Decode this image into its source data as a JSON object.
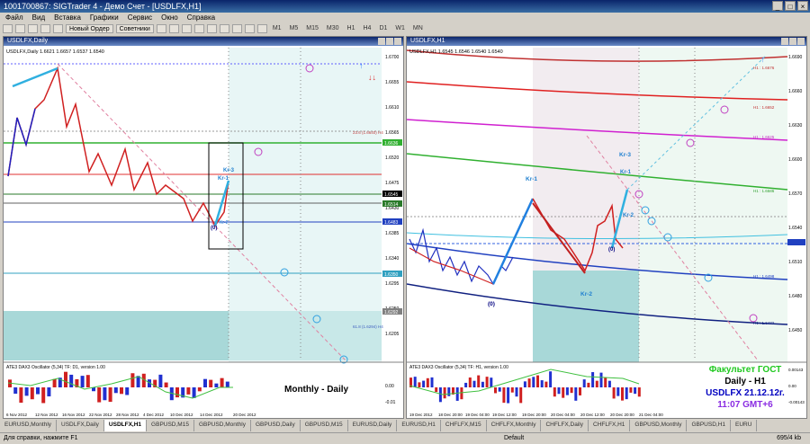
{
  "app": {
    "title": "1001700867: SIGTrader 4 - Демо Счет - [USDLFX,H1]",
    "menu": [
      "Файл",
      "Вид",
      "Вставка",
      "Графики",
      "Сервис",
      "Окно",
      "Справка"
    ],
    "toolbar": {
      "new_order": "Новый Ордер",
      "advisors": "Советники",
      "timeframes": [
        "M1",
        "M5",
        "M15",
        "M30",
        "H1",
        "H4",
        "D1",
        "W1",
        "MN"
      ]
    }
  },
  "left_chart": {
    "window_title": "USDLFX,Daily",
    "header": "USDLFX,Daily 1.6621 1.6657 1.6537 1.6540",
    "price_labels": [
      "1.6700",
      "1.6655",
      "1.6610",
      "1.6565",
      "1.6520",
      "1.6475",
      "1.6430",
      "1.6385",
      "1.6340",
      "1.6295",
      "1.6250",
      "1.6205"
    ],
    "level_labels": [
      "1.6636",
      "1.6545",
      "1.6514",
      "1.6483",
      "1.6350",
      "1.6292"
    ],
    "annotations": {
      "kr3": "Kr-3",
      "kr1": "Kr-1",
      "zero": "(0)",
      "kr2": "Kr-2",
      "l23": "23.6 (1.6640) H4",
      "l61": "61.8 (1.6294) H4"
    },
    "osc_header": "ATE3 DAX3 Oscillator (5,34) TF: D1, version 1.00",
    "osc_value_labels": [
      "0.00",
      "-0.01"
    ],
    "date_labels": [
      "6 Nov 2012",
      "12 Nov 2012",
      "16 Nov 2012",
      "22 Nov 2012",
      "28 Nov 2012",
      "4 Dec 2012",
      "10 Dec 2012",
      "14 Dec 2012",
      "20 Dec 2012"
    ],
    "label": "Monthly - Daily"
  },
  "right_chart": {
    "window_title": "USDLFX,H1",
    "header": "USDLFX,H1 1.6545 1.6546 1.6540 1.6540",
    "price_labels": [
      "1.6690",
      "1.6660",
      "1.6630",
      "1.6600",
      "1.6570",
      "1.6540",
      "1.6510",
      "1.6480",
      "1.6450"
    ],
    "level_labels": [
      "H1 : 1.6676",
      "H1 : 1.6652",
      "H1 : 1.6625",
      "H1 : 1.6586",
      "H1 : 1.6498",
      "H1 : 1.6472"
    ],
    "annotations": {
      "kr1_left": "Kr-1",
      "kr3": "Kr-3",
      "kr1_right": "Kr-1",
      "kr2_right": "Kr-2",
      "kr2_bottom": "Kr-2",
      "zero_left": "(0)",
      "zero_right": "(0)"
    },
    "osc_header": "ATE3 DAX3 Oscillator (5,34) TF: H1, version 1.00",
    "osc_value_labels": [
      "0.00143",
      "0.00",
      "-0.00143"
    ],
    "date_labels": [
      "19 Dec 2012",
      "18 Dec 20:00",
      "19 Dec 04:00",
      "19 Dec 12:00",
      "19 Dec 20:00",
      "20 Dec 04:00",
      "20 Dec 12:00",
      "20 Dec 20:00",
      "21 Dec 04:00"
    ]
  },
  "info": {
    "line1": "Факультет ГОСТ",
    "line2": "Daily - H1",
    "line3": "USDLFX 21.12.12г.",
    "line4": "11:07   GMT+6",
    "colors": {
      "line1": "#1ec81e",
      "line2": "#000000",
      "line3": "#0000c0",
      "line4": "#8a2be2"
    }
  },
  "tabs": [
    "EURUSD,Monthly",
    "USDLFX,Daily",
    "USDLFX,H1",
    "GBPUSD,M15",
    "GBPUSD,Monthly",
    "GBPUSD,Daily",
    "GBPUSD,M15",
    "EURUSD,Daily",
    "EURUSD,H1",
    "CHFLFX,M15",
    "CHFLFX,Monthly",
    "CHFLFX,Daily",
    "CHFLFX,H1",
    "GBPUSD,Monthly",
    "GBPUSD,H1",
    "EURU"
  ],
  "active_tab": "USDLFX,H1",
  "status": {
    "left": "Для справки, нажмите F1",
    "middle": "Default",
    "right": "695/4 kb"
  }
}
